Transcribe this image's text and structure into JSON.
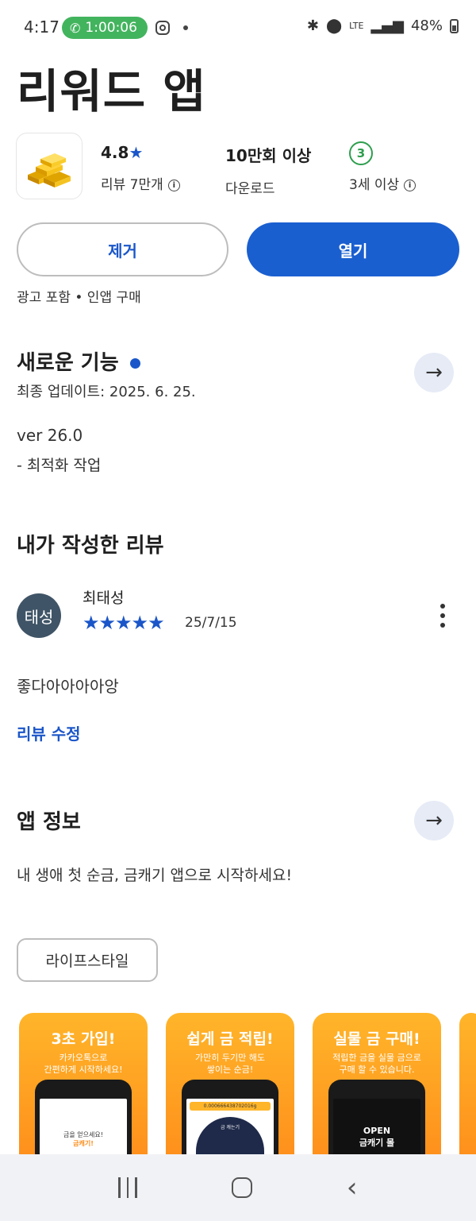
{
  "status_bar": {
    "time": "4:17",
    "call_timer": "1:00:06",
    "network": "LTE",
    "battery": "48%"
  },
  "app": {
    "title": "리워드 앱",
    "rating": "4.8",
    "reviews_label": "리뷰 7만개",
    "downloads": "10만회 이상",
    "downloads_label": "다운로드",
    "age_rating": "3",
    "age_label": "3세 이상"
  },
  "actions": {
    "remove_label": "제거",
    "open_label": "열기",
    "ads_note": "광고 포함 • 인앱 구매"
  },
  "whats_new": {
    "title": "새로운 기능",
    "updated": "최종 업데이트: 2025. 6. 25.",
    "version": "ver 26.0",
    "note": "- 최적화 작업"
  },
  "my_review": {
    "title": "내가 작성한 리뷰",
    "avatar_text": "태성",
    "reviewer": "최태성",
    "stars": 5,
    "date": "25/7/15",
    "body": "좋다아아아아앙",
    "edit_link": "리뷰 수정"
  },
  "app_info": {
    "title": "앱 정보",
    "description": "내 생애 첫 순금, 금캐기 앱으로 시작하세요!",
    "category": "라이프스타일"
  },
  "screenshots": [
    {
      "heading": "3초 가입!",
      "sub1": "카카오톡으로",
      "sub2": "간편하게 시작하세요!",
      "screen_text1": "금을 얻으세요!",
      "screen_text2": "금캐기!"
    },
    {
      "heading": "쉽게 금 적립!",
      "sub1": "가만히 두기만 해도",
      "sub2": "쌓이는 순금!",
      "screen_text1": "0.000666438702016g",
      "screen_text2": "금 캐는기"
    },
    {
      "heading": "실물 금 구매!",
      "sub1": "적립한 금을 실물 금으로",
      "sub2": "구매 할 수 있습니다.",
      "screen_text1": "OPEN",
      "screen_text2": "금캐기 몰"
    }
  ],
  "colors": {
    "accent_blue": "#1a5fd0",
    "call_green": "#43b45e",
    "avatar_bg": "#3f5466"
  }
}
